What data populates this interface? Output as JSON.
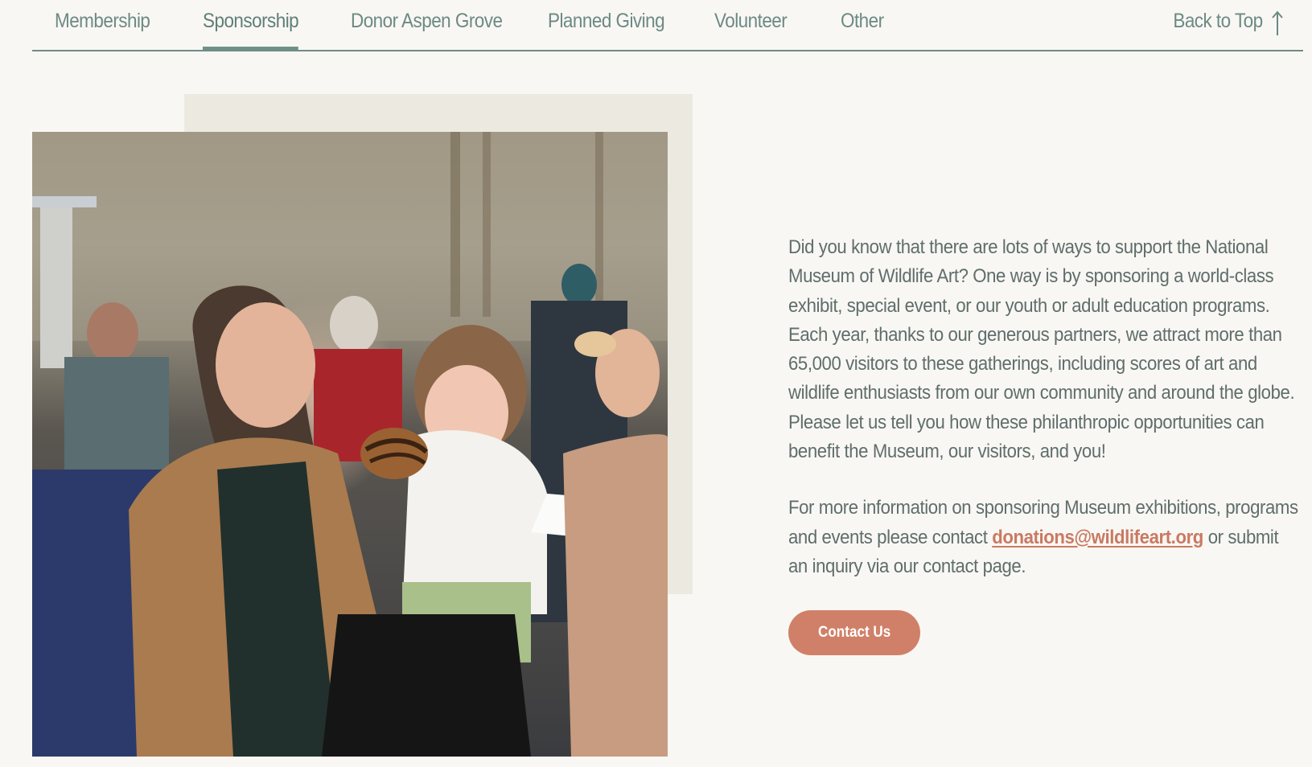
{
  "nav": {
    "tabs": [
      {
        "label": "Membership"
      },
      {
        "label": "Sponsorship"
      },
      {
        "label": "Donor Aspen Grove"
      },
      {
        "label": "Planned Giving"
      },
      {
        "label": "Volunteer"
      },
      {
        "label": "Other"
      }
    ],
    "active_tab": "Sponsorship",
    "back_to_top": "Back to Top",
    "back_to_top_icon": "arrow-up-icon"
  },
  "photo": {
    "subject": "photo-woman-holding-child-with-donut"
  },
  "content": {
    "paragraph1": "Did you know that there are lots of ways to support the National Museum of Wildlife Art? One way is by sponsoring a world-class exhibit, special event, or our youth or adult education programs. Each year, thanks to our generous partners, we attract more than 65,000 visitors to these gatherings, including scores of art and wildlife enthusiasts from our own community and around the globe. Please let us tell you how these philanthropic opportunities can benefit the Museum, our visitors, and you!",
    "paragraph2_before": "For more information on sponsoring Museum exhibitions, programs and events please contact ",
    "email": "donations@wildlifeart.org",
    "paragraph2_after": " or submit an inquiry via our contact page.",
    "button_label": "Contact Us"
  },
  "colors": {
    "background": "#f9f7f4",
    "nav_text": "#6c8a84",
    "body_text": "#5f6e6b",
    "accent": "#d08068",
    "link": "#c97a62",
    "photo_backdrop": "#eceae0"
  }
}
